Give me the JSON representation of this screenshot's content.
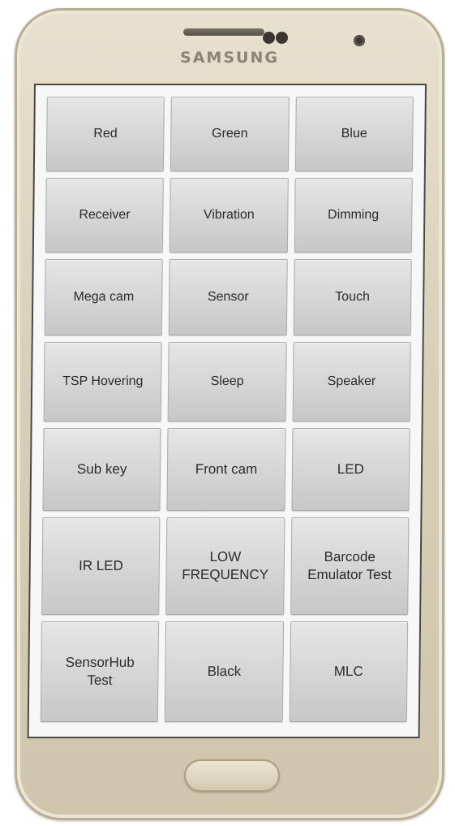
{
  "device": {
    "brand": "SAMSUNG"
  },
  "test_menu": {
    "buttons": [
      {
        "label": "Red"
      },
      {
        "label": "Green"
      },
      {
        "label": "Blue"
      },
      {
        "label": "Receiver"
      },
      {
        "label": "Vibration"
      },
      {
        "label": "Dimming"
      },
      {
        "label": "Mega cam"
      },
      {
        "label": "Sensor"
      },
      {
        "label": "Touch"
      },
      {
        "label": "TSP Hovering"
      },
      {
        "label": "Sleep"
      },
      {
        "label": "Speaker"
      },
      {
        "label": "Sub key"
      },
      {
        "label": "Front cam"
      },
      {
        "label": "LED"
      },
      {
        "label": "IR LED"
      },
      {
        "label": "LOW\nFREQUENCY"
      },
      {
        "label": "Barcode\nEmulator Test"
      },
      {
        "label": "SensorHub\nTest"
      },
      {
        "label": "Black"
      },
      {
        "label": "MLC"
      }
    ]
  }
}
